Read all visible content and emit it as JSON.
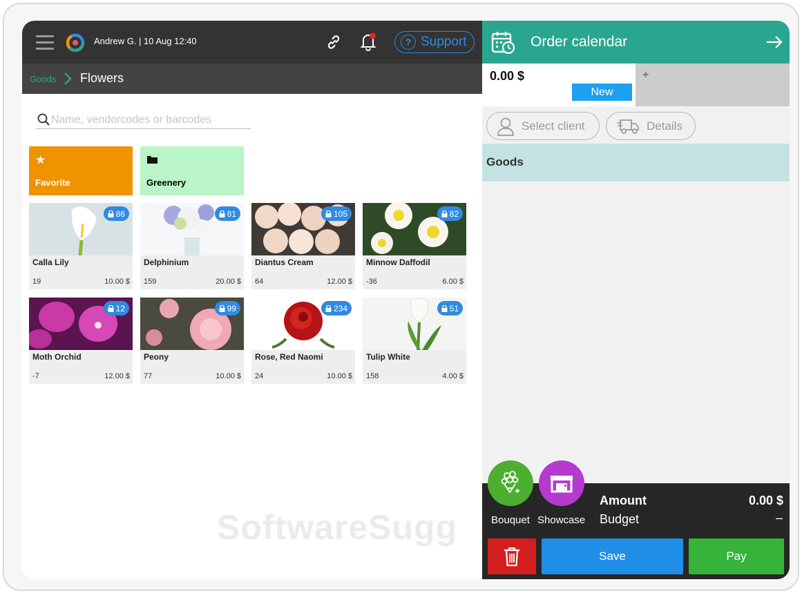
{
  "header": {
    "user": "Andrew G.",
    "datetime": "10 Aug 12:40",
    "user_line": "Andrew G.  | 10 Aug 12:40",
    "support_label": "Support"
  },
  "breadcrumb": {
    "root": "Goods",
    "current": "Flowers"
  },
  "search": {
    "placeholder": "Name, vendorcodes or barcodes"
  },
  "categories": [
    {
      "label": "Favorite",
      "icon": "star-icon",
      "color": "#f09300"
    },
    {
      "label": "Greenery",
      "icon": "folder-icon",
      "color": "#b9f5c7"
    }
  ],
  "products": [
    {
      "name": "Calla Lily",
      "stock": "19",
      "price": "10.00 $",
      "badge": "86"
    },
    {
      "name": "Delphinium",
      "stock": "159",
      "price": "20.00 $",
      "badge": "81"
    },
    {
      "name": "Diantus Cream",
      "stock": "64",
      "price": "12.00 $",
      "badge": "105"
    },
    {
      "name": "Minnow Daffodil",
      "stock": "-36",
      "price": "6.00 $",
      "badge": "82"
    },
    {
      "name": "Moth Orchid",
      "stock": "-7",
      "price": "12.00 $",
      "badge": "12"
    },
    {
      "name": "Peony",
      "stock": "77",
      "price": "10.00 $",
      "badge": "99"
    },
    {
      "name": "Rose, Red Naomi",
      "stock": "24",
      "price": "10.00 $",
      "badge": "234"
    },
    {
      "name": "Tulip White",
      "stock": "158",
      "price": "4.00 $",
      "badge": "51"
    }
  ],
  "watermark": "SoftwareSugg",
  "order": {
    "title": "Order calendar",
    "amount": "0.00 $",
    "status": "New",
    "add_tab": "+",
    "select_client": "Select client",
    "details": "Details",
    "goods_label": "Goods",
    "bouquet_label": "Bouquet",
    "showcase_label": "Showcase",
    "amount_label": "Amount",
    "amount_value": "0.00 $",
    "budget_label": "Budget",
    "budget_value": "–",
    "save_label": "Save",
    "pay_label": "Pay"
  },
  "colors": {
    "accent_teal": "#2aa690",
    "support_blue": "#2f8ae0",
    "save_blue": "#1f8ee6",
    "pay_green": "#35b33a",
    "delete_red": "#d51e1e",
    "bouquet_green": "#4caf2f",
    "showcase_purple": "#b43ad0"
  }
}
